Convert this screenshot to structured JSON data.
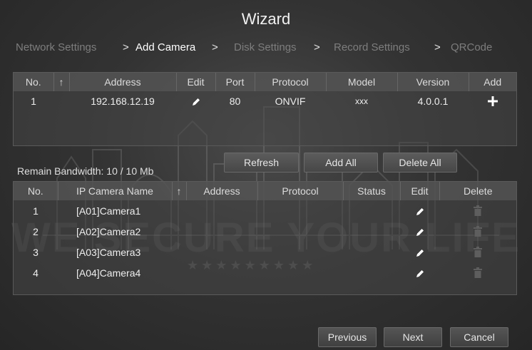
{
  "window": {
    "title": "Wizard"
  },
  "steps": [
    {
      "label": "Network Settings",
      "active": false
    },
    {
      "label": "Add Camera",
      "active": true
    },
    {
      "label": "Disk Settings",
      "active": false
    },
    {
      "label": "Record Settings",
      "active": false
    },
    {
      "label": "QRCode",
      "active": false
    }
  ],
  "step_separator": ">",
  "search_table": {
    "columns": [
      "No.",
      "Address",
      "Edit",
      "Port",
      "Protocol",
      "Model",
      "Version",
      "Add"
    ],
    "sort_indicator": "↑",
    "rows": [
      {
        "no": "1",
        "address": "192.168.12.19",
        "port": "80",
        "protocol": "ONVIF",
        "model": "xxx",
        "version": "4.0.0.1"
      }
    ]
  },
  "buttons": {
    "refresh": "Refresh",
    "add_all": "Add All",
    "delete_all": "Delete All",
    "previous": "Previous",
    "next": "Next",
    "cancel": "Cancel"
  },
  "bandwidth": {
    "text": "Remain Bandwidth: 10 / 10 Mb"
  },
  "added_table": {
    "columns": [
      "No.",
      "IP Camera Name",
      "Address",
      "Protocol",
      "Status",
      "Edit",
      "Delete"
    ],
    "sort_indicator": "↑",
    "rows": [
      {
        "no": "1",
        "name": "[A01]Camera1"
      },
      {
        "no": "2",
        "name": "[A02]Camera2"
      },
      {
        "no": "3",
        "name": "[A03]Camera3"
      },
      {
        "no": "4",
        "name": "[A04]Camera4"
      }
    ]
  },
  "watermark": {
    "text": "WE SECURE YOUR LIFE",
    "stars": "★★★★★★★★★"
  },
  "icons": {
    "edit": "pencil-icon",
    "add": "plus-icon",
    "delete": "trash-icon",
    "sort": "sort-up-icon"
  },
  "colors": {
    "background": "#333333",
    "header": "#555555",
    "active_step": "#ffffff",
    "inactive_step": "#7d7d7d",
    "delete_icon": "#5e5e5e"
  }
}
